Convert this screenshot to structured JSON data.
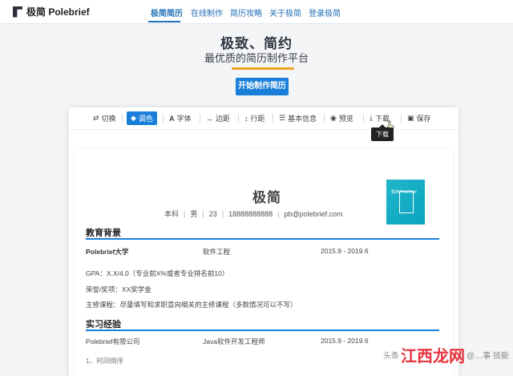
{
  "nav": {
    "logo_text": "极简 Polebrief",
    "items": [
      {
        "label": "极简简历"
      },
      {
        "label": "在线制作"
      },
      {
        "label": "简历攻略"
      },
      {
        "label": "关于极简"
      },
      {
        "label": "登录极简"
      }
    ]
  },
  "hero": {
    "title": "极致、简约",
    "subtitle": "最优质的简历制作平台",
    "start_button": "开始制作简历"
  },
  "toolbar": {
    "items": [
      {
        "label": "切换",
        "icon": "swap-icon"
      },
      {
        "label": "调色",
        "icon": "palette-icon"
      },
      {
        "label": "字体",
        "icon": "font-icon"
      },
      {
        "label": "边距",
        "icon": "margin-icon"
      },
      {
        "label": "行距",
        "icon": "line-spacing-icon"
      },
      {
        "label": "基本信息",
        "icon": "list-icon"
      },
      {
        "label": "预览",
        "icon": "eye-icon"
      },
      {
        "label": "下载",
        "icon": "download-icon"
      },
      {
        "label": "保存",
        "icon": "save-icon"
      }
    ],
    "tooltip": "下载"
  },
  "resume": {
    "name": "极简",
    "contact": [
      "本科",
      "男",
      "23",
      "18888888888",
      "pb@polebrief.com"
    ],
    "photo_text": "极简 PoleBrief",
    "education": {
      "title": "教育背景",
      "school": "Polebrief大学",
      "major": "软件工程",
      "period": "2015.9 - 2019.6",
      "lines": [
        "GPA：X.X/4.0（专业前X%或者专业排名前10）",
        "荣誉/奖项：XX奖学金",
        "主修课程：尽量填写和求职意向相关的主修课程（多数情况可以不写）"
      ]
    },
    "internship": {
      "title": "实习经验",
      "company": "Polebrief有限公司",
      "position": "Java软件开发工程师",
      "period": "2015.9 - 2019.6",
      "partial": "1、时间倒序"
    }
  },
  "watermark": {
    "prefix": "头条",
    "brand": "江西龙网",
    "suffix": "@…事 技能"
  },
  "colors": {
    "accent": "#1a7fd8",
    "orange": "#f1a21f",
    "watermark_red": "#e8323c"
  }
}
